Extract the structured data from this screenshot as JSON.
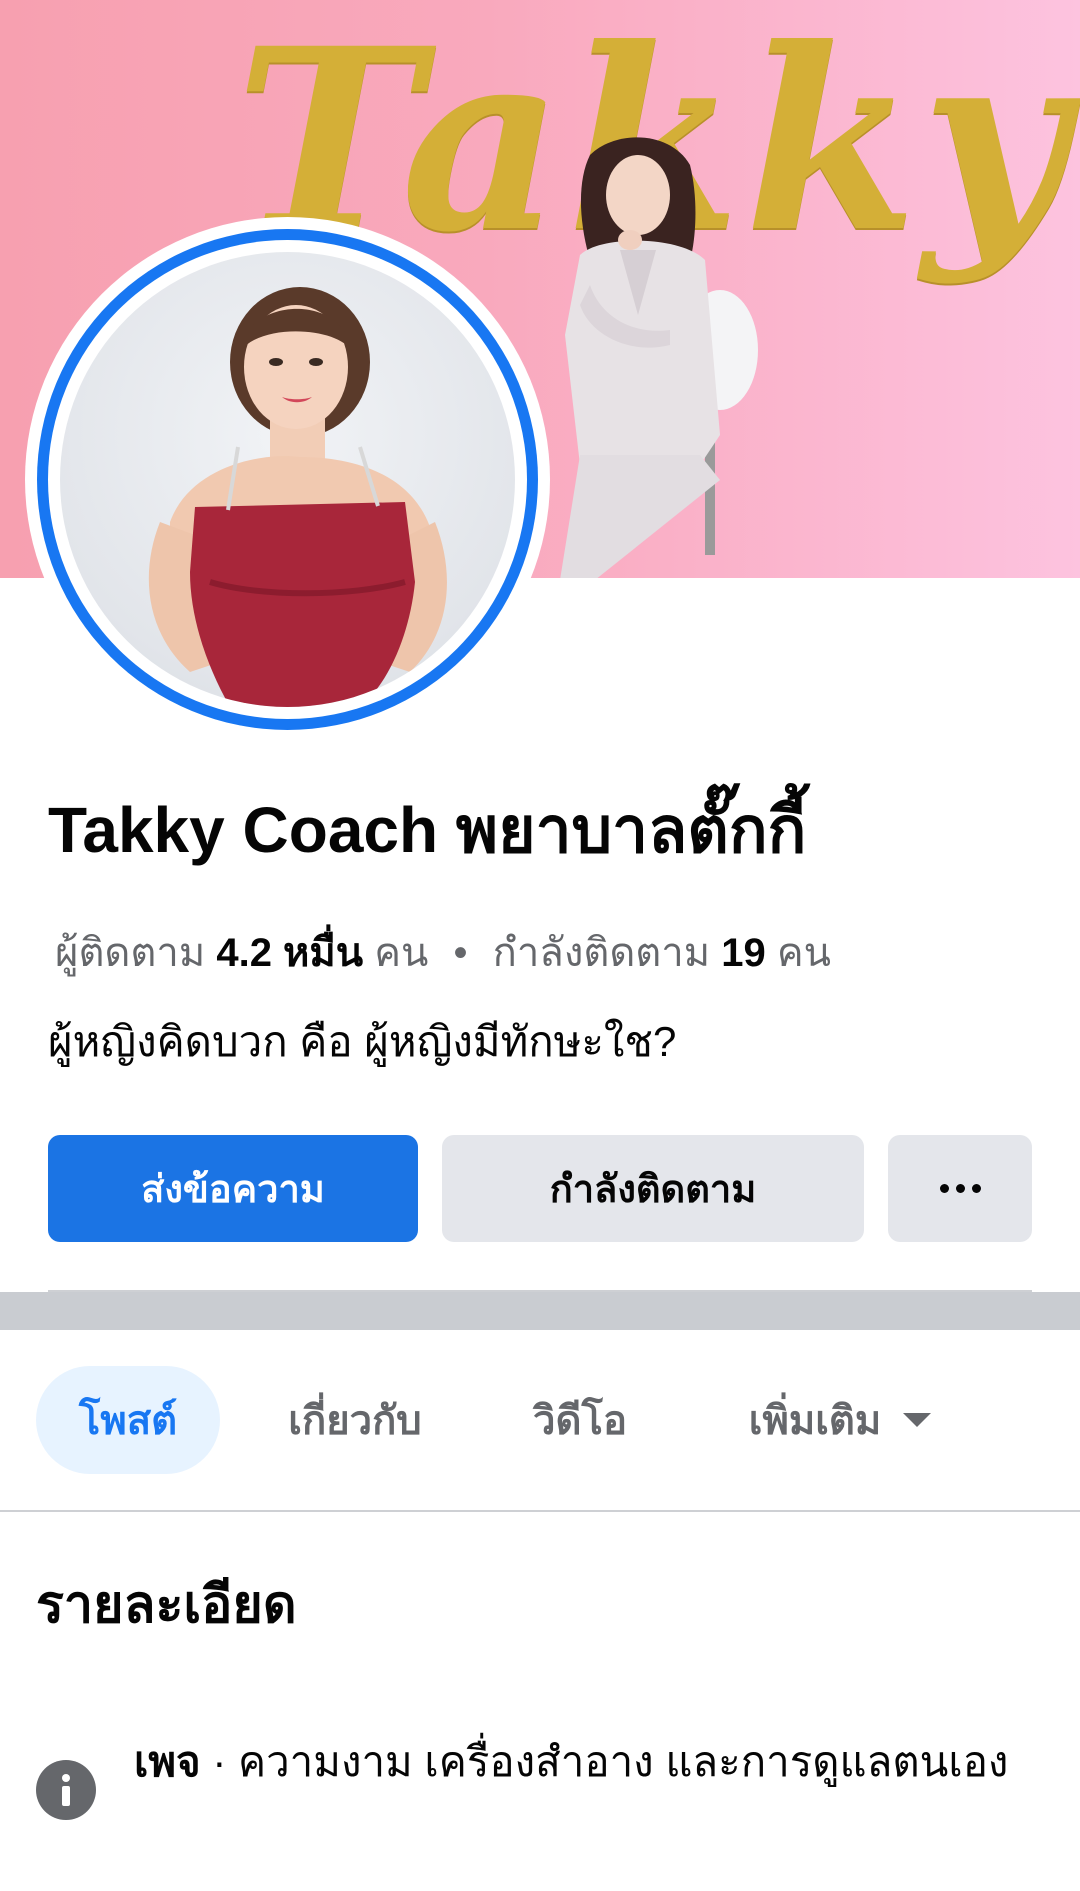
{
  "cover": {
    "script_text": "Takky"
  },
  "profile": {
    "name": "Takky Coach พยาบาลตั๊กกี้",
    "followers_label": "ผู้ติดตาม",
    "followers_count": "4.2 หมื่น",
    "followers_unit": "คน",
    "separator": "•",
    "following_label": "กำลังติดตาม",
    "following_count": "19",
    "following_unit": "คน",
    "bio": "ผู้หญิงคิดบวก คือ ผู้หญิงมีทักษะใช?"
  },
  "actions": {
    "message_label": "ส่งข้อความ",
    "following_label": "กำลังติดตาม",
    "more_icon": "more-horizontal-icon"
  },
  "tabs": [
    {
      "label": "โพสต์",
      "active": true
    },
    {
      "label": "เกี่ยวกับ",
      "active": false
    },
    {
      "label": "วิดีโอ",
      "active": false
    },
    {
      "label": "เพิ่มเติม",
      "active": false
    }
  ],
  "details": {
    "title": "รายละเอียด",
    "item_icon": "info-icon",
    "category_label": "เพจ",
    "category_separator": "·",
    "category_value": "ความงาม เครื่องสำอาง และการดูแลตนเอง"
  },
  "colors": {
    "accent": "#1b74e4",
    "button_secondary": "#e4e6eb",
    "tab_active_bg": "#e7f3ff",
    "muted_text": "#65676b",
    "avatar_ring": "#1877f2"
  }
}
